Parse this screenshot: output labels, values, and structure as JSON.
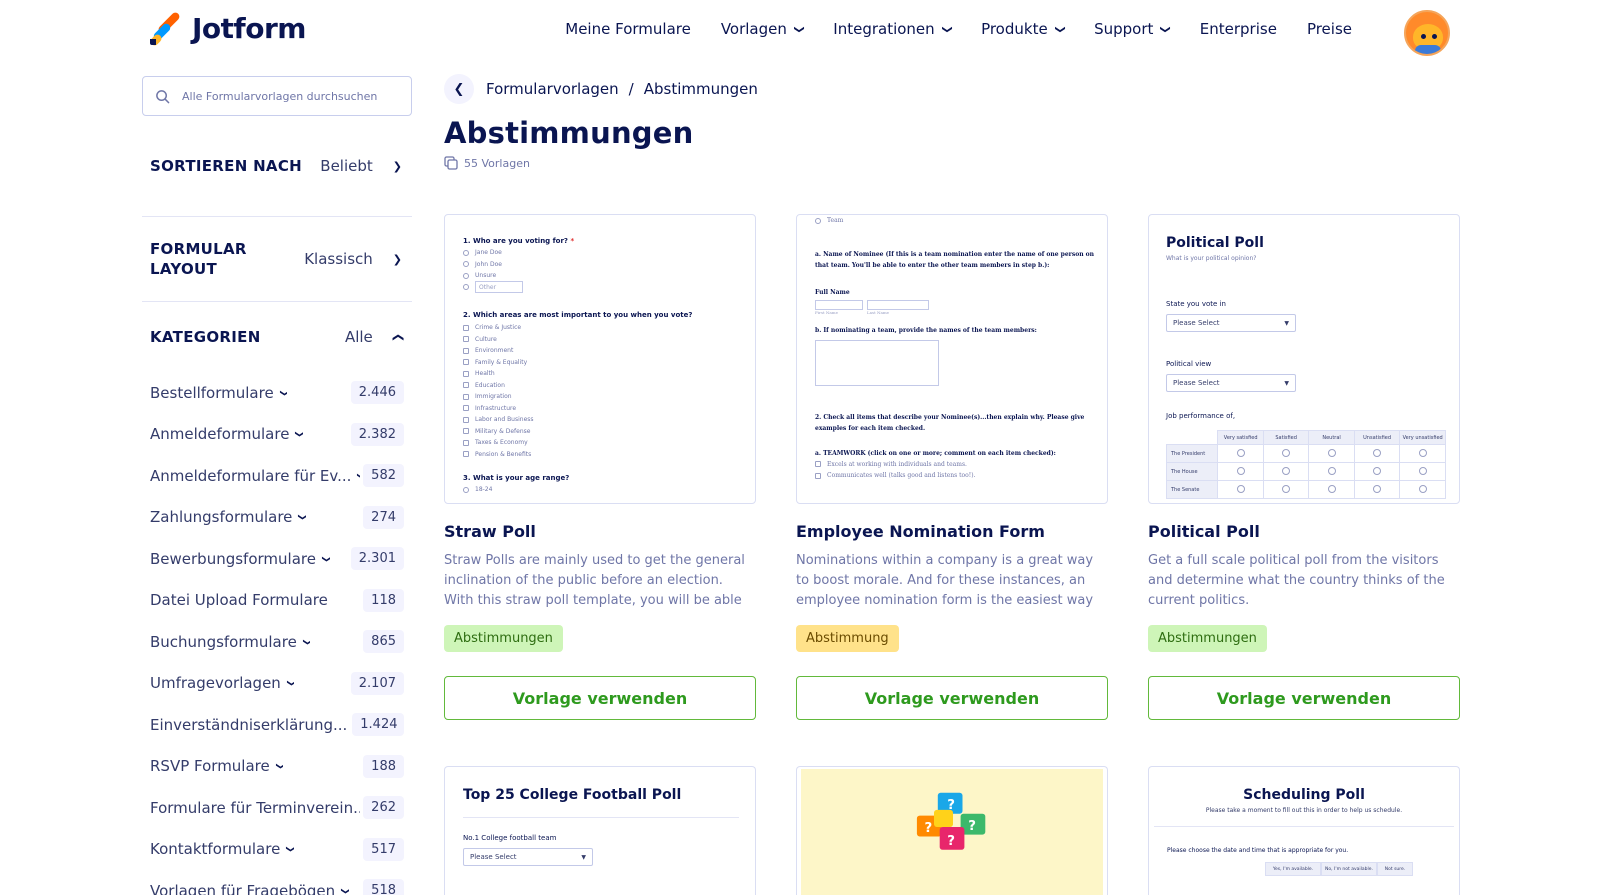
{
  "header": {
    "logo_text": "Jotform",
    "nav": [
      {
        "label": "Meine Formulare",
        "dropdown": false
      },
      {
        "label": "Vorlagen",
        "dropdown": true
      },
      {
        "label": "Integrationen",
        "dropdown": true
      },
      {
        "label": "Produkte",
        "dropdown": true
      },
      {
        "label": "Support",
        "dropdown": true
      },
      {
        "label": "Enterprise",
        "dropdown": false
      },
      {
        "label": "Preise",
        "dropdown": false
      }
    ]
  },
  "sidebar": {
    "search_placeholder": "Alle Formularvorlagen durchsuchen",
    "sort_label": "SORTIEREN NACH",
    "sort_value": "Beliebt",
    "layout_label": "FORMULAR LAYOUT",
    "layout_value": "Klassisch",
    "categories_label": "KATEGORIEN",
    "categories_value": "Alle",
    "categories": [
      {
        "name": "Bestellformulare",
        "count": "2.446",
        "dropdown": true
      },
      {
        "name": "Anmeldeformulare",
        "count": "2.382",
        "dropdown": true
      },
      {
        "name": "Anmeldeformulare für Ev...",
        "count": "582",
        "dropdown": true
      },
      {
        "name": "Zahlungsformulare",
        "count": "274",
        "dropdown": true
      },
      {
        "name": "Bewerbungsformulare",
        "count": "2.301",
        "dropdown": true
      },
      {
        "name": "Datei Upload Formulare",
        "count": "118",
        "dropdown": false
      },
      {
        "name": "Buchungsformulare",
        "count": "865",
        "dropdown": true
      },
      {
        "name": "Umfragevorlagen",
        "count": "2.107",
        "dropdown": true
      },
      {
        "name": "Einverständniserklärung...",
        "count": "1.424",
        "dropdown": true
      },
      {
        "name": "RSVP Formulare",
        "count": "188",
        "dropdown": true
      },
      {
        "name": "Formulare für Terminverein...",
        "count": "262",
        "dropdown": false
      },
      {
        "name": "Kontaktformulare",
        "count": "517",
        "dropdown": true
      },
      {
        "name": "Vorlagen für Fragebögen",
        "count": "518",
        "dropdown": true
      }
    ]
  },
  "main": {
    "breadcrumb": [
      "Formularvorlagen",
      "Abstimmungen"
    ],
    "breadcrumb_sep": "/",
    "title": "Abstimmungen",
    "count_text": "55 Vorlagen",
    "use_label": "Vorlage verwenden",
    "cards": [
      {
        "title": "Straw Poll",
        "desc": "Straw Polls are mainly used to get the general inclination of the public before an election. With this straw poll template, you will be able to colle...",
        "tag": "Abstimmungen",
        "tag_color": "#cef5b8",
        "preview": {
          "q1": "1. Who are you voting for?",
          "q1_req": "*",
          "q1_opts": [
            "Jane Doe",
            "John Doe",
            "Unsure"
          ],
          "q1_other": "Other",
          "q2": "2. Which areas are most important to you when you vote?",
          "q2_opts": [
            "Crime & Justice",
            "Culture",
            "Environment",
            "Family & Equality",
            "Health",
            "Education",
            "Immigration",
            "Infrastructure",
            "Labor and Business",
            "Military & Defense",
            "Taxes & Economy",
            "Pension & Benefits"
          ],
          "q3": "3. What is your age range?",
          "q3_opt": "18-24"
        }
      },
      {
        "title": "Employee Nomination Form",
        "desc": "Nominations within a company is a great way to boost morale. And for these instances, an employee nomination form is the easiest way to...",
        "tag": "Abstimmung",
        "tag_color": "#ffe28a",
        "preview": {
          "team": "Team",
          "a": "a. Name of Nominee (If this is a team nomination enter the name of one person on that team. You'll be able to enter the other team members in step b.):",
          "full_name": "Full Name",
          "first": "First Name",
          "last": "Last Name",
          "b": "b. If nominating a team, provide the names of the team members:",
          "c": "2. Check all items that describe your Nominee(s)...then explain why. Please give examples for each item checked.",
          "d": "a. TEAMWORK (click on one or more; comment on each item checked):",
          "d_opts": [
            "Excels at working with individuals and teams.",
            "Communicates well (talks good and listens too!)."
          ]
        }
      },
      {
        "title": "Political Poll",
        "desc": "Get a full scale political poll from the visitors and determine what the country thinks of the current politics.",
        "tag": "Abstimmungen",
        "tag_color": "#cef5b8",
        "preview": {
          "heading": "Political Poll",
          "sub": "What is your political opinion?",
          "state_label": "State you vote in",
          "select": "Please Select",
          "view_label": "Political view",
          "perf_label": "Job performance of,",
          "cols": [
            "Very satisfied",
            "Satisfied",
            "Neutral",
            "Unsatisfied",
            "Very unsatisfied"
          ],
          "rows": [
            "The President",
            "The House",
            "The Senate"
          ]
        }
      },
      {
        "title": "",
        "preview": {
          "heading": "Top 25 College Football Poll",
          "field": "No.1 College football team",
          "select": "Please Select"
        }
      },
      {
        "title": "",
        "preview": {
          "bg": "#fdf6c8"
        }
      },
      {
        "title": "",
        "preview": {
          "heading": "Scheduling Poll",
          "sub": "Please take a moment to fill out this in order to help us schedule.",
          "q": "Please choose the date and time that is appropriate for you.",
          "cols": [
            "Yes, I'm available.",
            "No, I'm not available.",
            "Not sure."
          ]
        }
      }
    ]
  },
  "colors": {
    "navy": "#0a1551",
    "green_button": "#2e9a1e",
    "tag_green": "#cef5b8",
    "tag_yellow": "#ffe28a"
  },
  "icons": {
    "logo": "jotform-logo-icon",
    "search": "search-icon",
    "chevron": "chevron-down-icon",
    "back": "chevron-left-icon",
    "templates": "copy-icon"
  }
}
